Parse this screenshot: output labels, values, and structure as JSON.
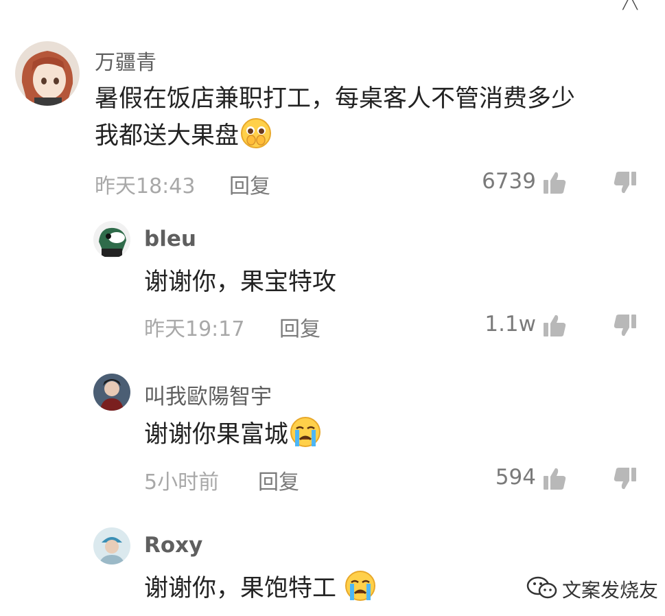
{
  "comments": [
    {
      "username": "万疆青",
      "text_line1": "暑假在饭店兼职打工，每桌客人不管消费多少",
      "text_line2": "我都送大果盘",
      "time": "昨天18:43",
      "reply": "回复",
      "likes": "6739",
      "emoji": "pleading-face"
    },
    {
      "username": "bleu",
      "text": "谢谢你，果宝特攻",
      "time": "昨天19:17",
      "reply": "回复",
      "likes": "1.1w"
    },
    {
      "username": "叫我歐陽智宇",
      "text": "谢谢你果富城",
      "time": "5小时前",
      "reply": "回复",
      "likes": "594",
      "emoji": "crying-face"
    },
    {
      "username": "Roxy",
      "text": "谢谢你，果饱特工",
      "emoji": "crying-face"
    }
  ],
  "watermark": {
    "text": "文案发烧友",
    "icon": "wechat-icon"
  },
  "colors": {
    "username": "#5f5f5f",
    "text": "#222222",
    "meta": "#a8a8a8",
    "likes": "#7a7a7a"
  }
}
